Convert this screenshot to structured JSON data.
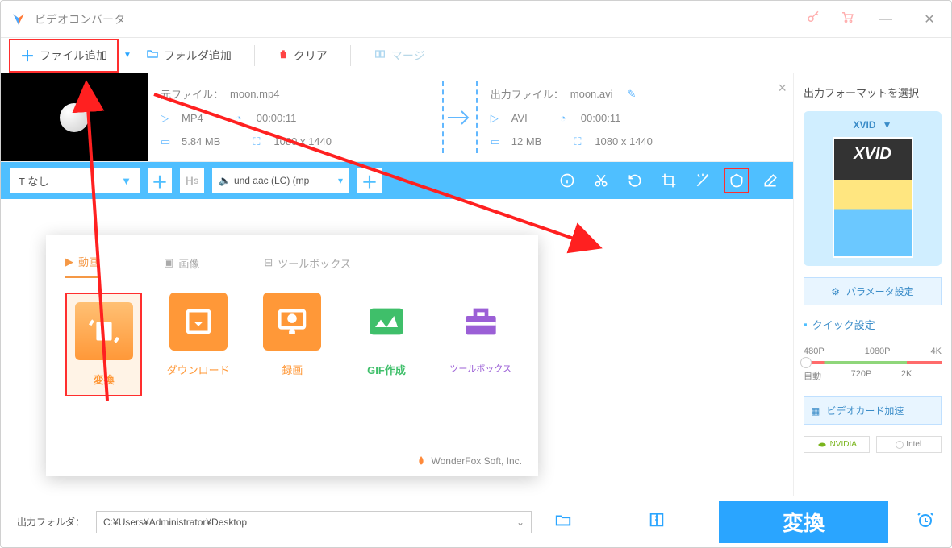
{
  "app": {
    "title": "ビデオコンバータ"
  },
  "toolbar": {
    "add_file": "ファイル追加",
    "add_folder": "フォルダ追加",
    "clear": "クリア",
    "merge": "マージ"
  },
  "file": {
    "src_label": "元ファイル：",
    "src_name": "moon.mp4",
    "src_format": "MP4",
    "src_duration": "00:00:11",
    "src_size": "5.84 MB",
    "src_res": "1080 x 1440",
    "out_label": "出力ファイル：",
    "out_name": "moon.avi",
    "out_format": "AVI",
    "out_duration": "00:00:11",
    "out_size": "12 MB",
    "out_res": "1080 x 1440"
  },
  "subtitle": {
    "value": "T なし"
  },
  "audio": {
    "value": "und aac (LC) (mp"
  },
  "tabs": {
    "video": "動画",
    "image": "画像",
    "toolbox": "ツールボックス"
  },
  "cards": {
    "convert": "変換",
    "download": "ダウンロード",
    "record": "録画",
    "gif": "GIF作成",
    "toolbox": "ツールボックス"
  },
  "credit": "WonderFox Soft, Inc.",
  "right": {
    "title": "出力フォーマットを選択",
    "format": "XVID",
    "param": "パラメータ設定",
    "quick": "クイック設定",
    "res": {
      "p480": "480P",
      "p720": "720P",
      "p1080": "1080P",
      "p2k": "2K",
      "p4k": "4K",
      "auto": "自動"
    },
    "gpu": "ビデオカード加速",
    "nvidia": "NVIDIA",
    "intel": "Intel"
  },
  "bottom": {
    "out_label": "出力フォルダ：",
    "path": "C:¥Users¥Administrator¥Desktop",
    "convert": "変換"
  }
}
